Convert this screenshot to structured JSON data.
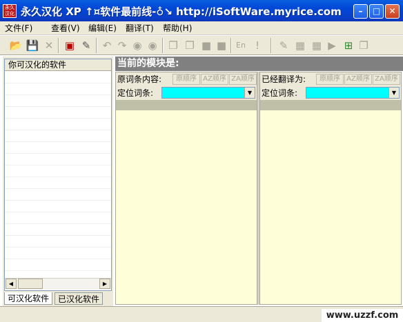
{
  "window": {
    "app_icon_text": "永久汉化",
    "title": "永久汉化 XP  ↑¤软件最前线-♁↘  http://iSoftWare.myrice.com",
    "min_label": "–",
    "max_label": "□",
    "close_label": "✕"
  },
  "menu": {
    "file": "文件(F)",
    "view": "查看(V)",
    "edit": "编辑(E)",
    "translate": "翻译(T)",
    "help": "帮助(H)"
  },
  "toolbar": {
    "icons": [
      "open-icon",
      "save-icon",
      "delete-icon",
      "book-icon",
      "brush-icon",
      "undo-icon",
      "redo-icon",
      "find-icon",
      "find-next-icon",
      "copy-icon",
      "copy-all-icon",
      "paste-icon",
      "clip-icon",
      "english-icon",
      "warning-icon",
      "pencil-icon",
      "image-icon",
      "edit-image-icon",
      "play-icon",
      "add-icon",
      "window-icon"
    ]
  },
  "left": {
    "list_header": "你可汉化的软件",
    "tabs": {
      "translatable": "可汉化软件",
      "translated": "已汉化软件"
    }
  },
  "module": {
    "title": "当前的模块是:"
  },
  "left_pane": {
    "label": "原词条内容:",
    "sort_original": "原顺序",
    "sort_az": "AZ顺序",
    "sort_za": "ZA顺序",
    "locate_label": "定位词条:"
  },
  "right_pane": {
    "label": "已经翻译为:",
    "sort_original": "原顺序",
    "sort_az": "AZ顺序",
    "sort_za": "ZA顺序",
    "locate_label": "定位词条:"
  },
  "watermark": "www.uzzf.com",
  "colors": {
    "title_bar": "#0a5fe0",
    "combo": "#00ffff",
    "pane_bg": "#fefed8",
    "module_bar": "#808080"
  }
}
